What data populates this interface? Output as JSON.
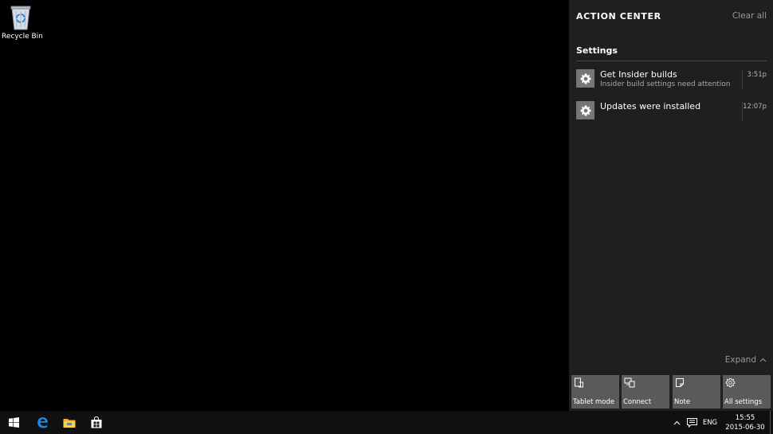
{
  "desktop": {
    "icons": [
      {
        "label": "Recycle Bin",
        "icon": "recycle-bin-icon"
      }
    ]
  },
  "action_center": {
    "title": "ACTION CENTER",
    "clear_all": "Clear all",
    "group": "Settings",
    "notifications": [
      {
        "title": "Get Insider builds",
        "subtitle": "Insider build settings need attention",
        "time": "3:51p",
        "icon": "gear-icon"
      },
      {
        "title": "Updates were installed",
        "subtitle": "",
        "time": "12:07p",
        "icon": "gear-icon"
      }
    ],
    "expand": "Expand",
    "quick_actions": [
      {
        "label": "Tablet mode",
        "icon": "tablet-mode-icon"
      },
      {
        "label": "Connect",
        "icon": "connect-icon"
      },
      {
        "label": "Note",
        "icon": "note-icon"
      },
      {
        "label": "All settings",
        "icon": "gear-icon"
      }
    ]
  },
  "taskbar": {
    "pinned": [
      "start-icon",
      "edge-icon",
      "file-explorer-icon",
      "store-icon"
    ],
    "language": "ENG",
    "time": "15:55",
    "date": "2015-06-30"
  },
  "colors": {
    "action_center_bg": "#1f1f1f",
    "tile_bg": "#5a5a5a",
    "notification_icon_bg": "#767676",
    "edge_blue": "#1e88e5"
  }
}
